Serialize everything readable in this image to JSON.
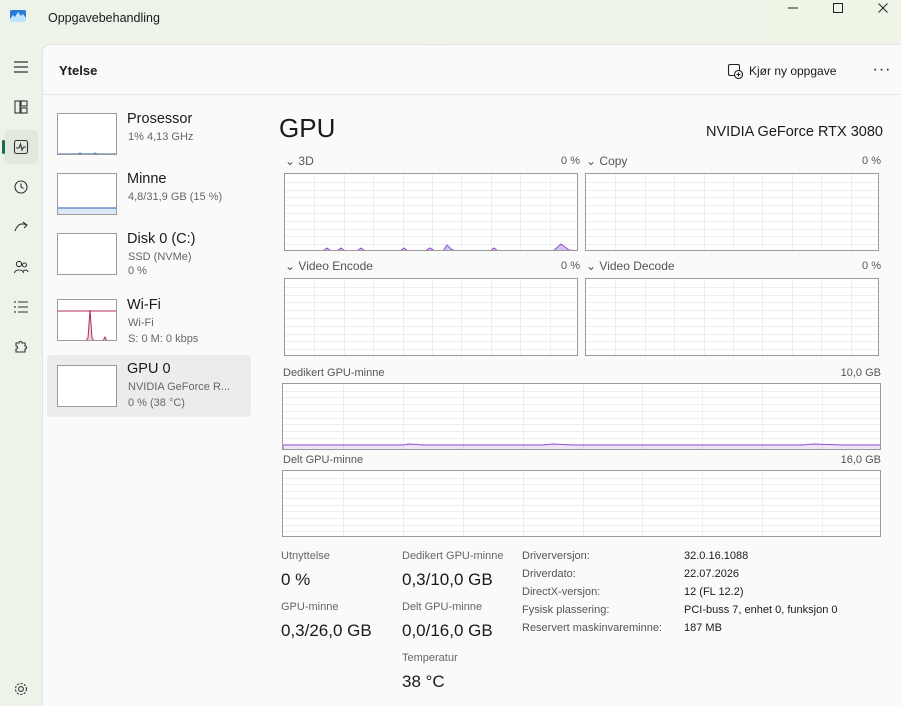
{
  "window": {
    "title": "Oppgavebehandling"
  },
  "header": {
    "title": "Ytelse",
    "run_task_label": "Kjør ny oppgave",
    "more_label": "···"
  },
  "sidebar": [
    {
      "title": "Prosessor",
      "line1": "1% 4,13 GHz",
      "line2": ""
    },
    {
      "title": "Minne",
      "line1": "4,8/31,9 GB (15 %)",
      "line2": ""
    },
    {
      "title": "Disk 0 (C:)",
      "line1": "SSD (NVMe)",
      "line2": "0 %"
    },
    {
      "title": "Wi-Fi",
      "line1": "Wi-Fi",
      "line2": "S: 0 M: 0 kbps"
    },
    {
      "title": "GPU 0",
      "line1": "NVIDIA GeForce R...",
      "line2": "0 % (38 °C)"
    }
  ],
  "gpu": {
    "heading": "GPU",
    "name": "NVIDIA GeForce RTX 3080",
    "engines": [
      {
        "label": "3D",
        "value": "0 %",
        "chevron": "⌄"
      },
      {
        "label": "Copy",
        "value": "0 %",
        "chevron": "⌄"
      },
      {
        "label": "Video Encode",
        "value": "0 %",
        "chevron": "⌄"
      },
      {
        "label": "Video Decode",
        "value": "0 %",
        "chevron": "⌄"
      }
    ],
    "dedicated_mem": {
      "label": "Dedikert GPU-minne",
      "value": "10,0 GB"
    },
    "shared_mem": {
      "label": "Delt GPU-minne",
      "value": "16,0 GB"
    }
  },
  "stats": {
    "utilization": {
      "label": "Utnyttelse",
      "value": "0 %"
    },
    "dedicated": {
      "label": "Dedikert GPU-minne",
      "value": "0,3/10,0 GB"
    },
    "gpu_memory": {
      "label": "GPU-minne",
      "value": "0,3/26,0 GB"
    },
    "shared": {
      "label": "Delt GPU-minne",
      "value": "0,0/16,0 GB"
    },
    "temperature": {
      "label": "Temperatur",
      "value": "38 °C"
    }
  },
  "properties": [
    {
      "key": "Driverversjon:",
      "value": "32.0.16.1088"
    },
    {
      "key": "Driverdato:",
      "value": "22.07.2026"
    },
    {
      "key": "DirectX-versjon:",
      "value": "12 (FL 12.2)"
    },
    {
      "key": "Fysisk plassering:",
      "value": "PCI-buss 7, enhet 0, funksjon 0"
    },
    {
      "key": "Reservert maskinvareminne:",
      "value": "187 MB"
    }
  ],
  "colors": {
    "accent": "#1b6b4f",
    "gpu_line": "#8e4fd6",
    "wifi_line": "#b02b5a",
    "memory_line": "#4a7fbf"
  }
}
